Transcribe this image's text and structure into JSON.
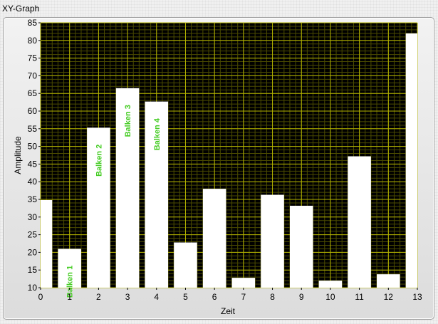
{
  "window": {
    "label": "XY-Graph"
  },
  "chart_data": {
    "type": "bar",
    "title": "",
    "xlabel": "Zeit",
    "ylabel": "Amplitude",
    "x": [
      0,
      1,
      2,
      3,
      4,
      5,
      6,
      7,
      8,
      9,
      10,
      11,
      12,
      13
    ],
    "values": [
      34.8,
      21,
      55.3,
      66.5,
      62.7,
      22.8,
      38,
      12.8,
      36.3,
      33.2,
      12,
      47.2,
      13.8,
      82
    ],
    "xlim": [
      0,
      13
    ],
    "ylim": [
      10,
      85
    ],
    "xticks": [
      0,
      1,
      2,
      3,
      4,
      5,
      6,
      7,
      8,
      9,
      10,
      11,
      12,
      13
    ],
    "yticks": [
      10,
      15,
      20,
      25,
      30,
      35,
      40,
      45,
      50,
      55,
      60,
      65,
      70,
      75,
      80,
      85
    ],
    "grid": true,
    "annotations": [
      {
        "x": 1,
        "text": "Balken 1"
      },
      {
        "x": 2,
        "text": "Balken 2"
      },
      {
        "x": 3,
        "text": "Balken 3"
      },
      {
        "x": 4,
        "text": "Balken 4"
      }
    ],
    "colors": {
      "plot_background": "#000000",
      "bar_fill": "#ffffff",
      "major_grid": "#b4b400",
      "minor_grid": "#4b4b00",
      "annotation_text": "#44cc22"
    }
  }
}
